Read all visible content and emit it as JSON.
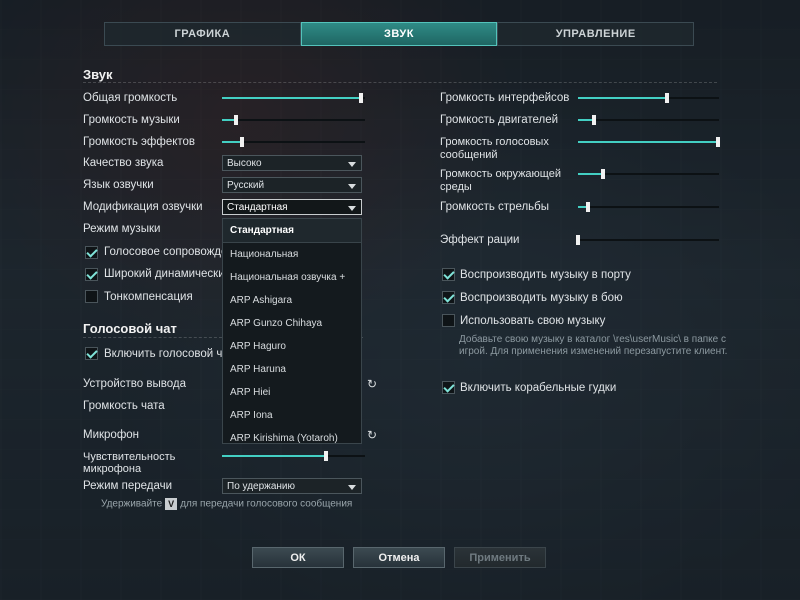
{
  "tabs": [
    {
      "label": "ГРАФИКА",
      "active": false
    },
    {
      "label": "ЗВУК",
      "active": true
    },
    {
      "label": "УПРАВЛЕНИЕ",
      "active": false
    }
  ],
  "sound": {
    "title": "Звук",
    "master_volume": {
      "label": "Общая громкость",
      "value": 0.97
    },
    "music_volume": {
      "label": "Громкость музыки",
      "value": 0.1
    },
    "effects_volume": {
      "label": "Громкость эффектов",
      "value": 0.14
    },
    "quality": {
      "label": "Качество звука",
      "value": "Высоко"
    },
    "voice_language": {
      "label": "Язык озвучки",
      "value": "Русский"
    },
    "voice_mod": {
      "label": "Модификация озвучки",
      "value": "Стандартная"
    },
    "music_mode": {
      "label": "Режим музыки"
    },
    "voice_accomp": {
      "label": "Голосовое сопровожден",
      "checked": true
    },
    "wide_dynamic": {
      "label": "Широкий динамический д",
      "checked": true
    },
    "tonecomp": {
      "label": "Тонкомпенсация",
      "checked": false
    }
  },
  "dropdown_options": [
    "Стандартная",
    "Национальная",
    "Национальная озвучка +",
    "ARP Ashigara",
    "ARP Gunzo Chihaya",
    "ARP Haguro",
    "ARP Haruna",
    "ARP Hiei",
    "ARP Iona",
    "ARP Kirishima (Yotaroh)"
  ],
  "voice_chat": {
    "title": "Голосовой чат",
    "enable": {
      "label": "Включить голосовой чат",
      "checked": true
    },
    "output_device": {
      "label": "Устройство вывода"
    },
    "chat_volume": {
      "label": "Громкость чата"
    },
    "microphone": {
      "label": "Микрофон"
    },
    "mic_sensitivity": {
      "label_1": "Чувствительность",
      "label_2": "микрофона",
      "value": 0.73
    },
    "transmit_mode": {
      "label": "Режим передачи",
      "value": "По удержанию"
    },
    "ptt_hint_before": "Удерживайте",
    "ptt_key": "V",
    "ptt_hint_after": "для передачи голосового сообщения"
  },
  "right": {
    "interface_volume": {
      "label": "Громкость интерфейсов",
      "value": 0.63
    },
    "engine_volume": {
      "label": "Громкость двигателей",
      "value": 0.11
    },
    "voice_msgs_volume": {
      "label_1": "Громкость голосовых",
      "label_2": "сообщений",
      "value": 0.99
    },
    "ambient_volume": {
      "label_1": "Громкость окружающей",
      "label_2": "среды",
      "value": 0.18
    },
    "shooting_volume": {
      "label": "Громкость стрельбы",
      "value": 0.07
    },
    "radio_effect": {
      "label": "Эффект рации",
      "value": 0.0
    },
    "music_in_port": {
      "label": "Воспроизводить музыку в порту",
      "checked": true
    },
    "music_in_battle": {
      "label": "Воспроизводить музыку в бою",
      "checked": true
    },
    "own_music": {
      "label": "Использовать свою музыку",
      "checked": false
    },
    "own_music_hint": "Добавьте свою музыку в каталог \\res\\userMusic\\ в папке с игрой. Для применения изменений перезапустите клиент.",
    "ship_horns": {
      "label": "Включить корабельные гудки",
      "checked": true
    }
  },
  "buttons": {
    "ok": "ОК",
    "cancel": "Отмена",
    "apply": "Применить"
  }
}
